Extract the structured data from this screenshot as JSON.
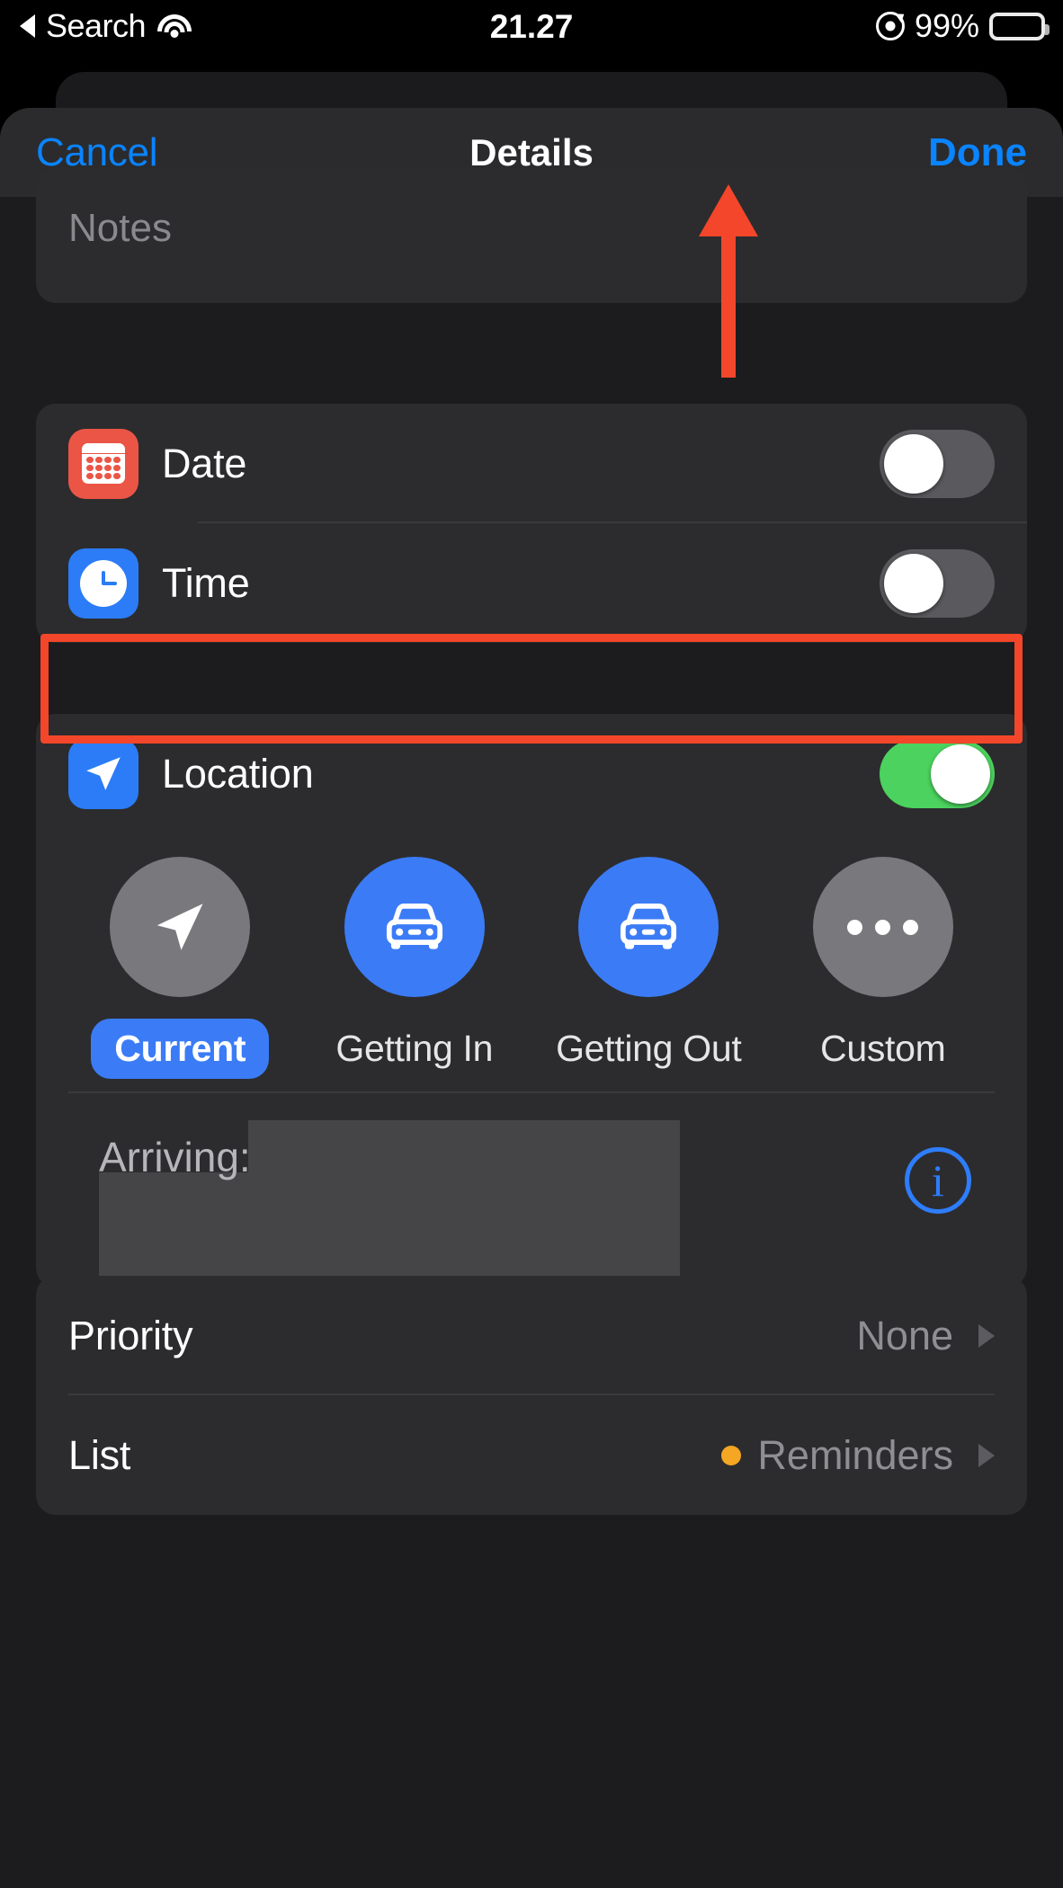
{
  "status_bar": {
    "back_label": "Search",
    "wifi_icon": "wifi-icon",
    "time": "21.27",
    "rotation_lock_icon": "rotation-lock-icon",
    "battery_percent": "99%",
    "battery_icon": "battery-icon"
  },
  "navbar": {
    "cancel_label": "Cancel",
    "title": "Details",
    "done_label": "Done"
  },
  "notes": {
    "placeholder": "Notes",
    "value": ""
  },
  "datetime_card": {
    "rows": [
      {
        "icon": "calendar-icon",
        "label": "Date",
        "toggle_state": "off"
      },
      {
        "icon": "clock-icon",
        "label": "Time",
        "toggle_state": "off"
      }
    ]
  },
  "location_card": {
    "row": {
      "icon": "navigation-arrow-icon",
      "label": "Location",
      "toggle_state": "on"
    },
    "options": [
      {
        "icon": "navigation-arrow-icon",
        "label": "Current",
        "selected": true,
        "circle_color": "#78787d"
      },
      {
        "icon": "car-icon",
        "label": "Getting In",
        "selected": false,
        "circle_color": "#3b7cf6"
      },
      {
        "icon": "car-icon",
        "label": "Getting Out",
        "selected": false,
        "circle_color": "#3b7cf6"
      },
      {
        "icon": "ellipsis-icon",
        "label": "Custom",
        "selected": false,
        "circle_color": "#78787d"
      }
    ],
    "arriving": {
      "label": "Arriving:",
      "value_redacted": true,
      "info_icon": "info-circle-icon"
    }
  },
  "options_card": {
    "rows": [
      {
        "label": "Priority",
        "value": "None",
        "chevron": "chevron-right-icon"
      },
      {
        "label": "List",
        "value": "Reminders",
        "dot_color": "#f5a623",
        "chevron": "chevron-right-icon"
      }
    ]
  },
  "annotations": {
    "highlight_color": "#f4462a",
    "arrow_target": "Done",
    "rect_target": "Location"
  },
  "colors": {
    "accent_blue": "#0a84ff",
    "toggle_on_green": "#4cd25e",
    "date_icon_red": "#eb5545",
    "list_dot_orange": "#f5a623",
    "sheet_bg": "#1c1c1e",
    "card_bg": "#2c2c2e"
  }
}
